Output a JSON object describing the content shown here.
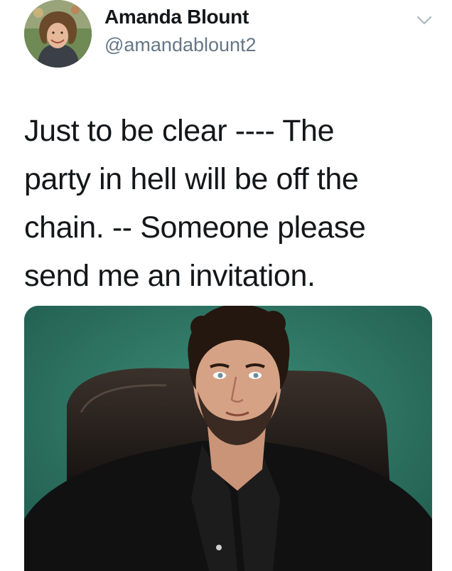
{
  "tweet": {
    "author_name": "Amanda Blount",
    "author_handle": "@amandablount2",
    "text_lines": [
      "Just to be clear ---- The",
      "party in hell will be off the",
      "chain. -- Someone please",
      "send me an invitation."
    ],
    "menu_icon": "chevron-down-icon",
    "avatar_icon": "user-avatar",
    "media_kind": "photo"
  },
  "colors": {
    "text": "#14171a",
    "secondary_text": "#657786",
    "chevron": "#aab8c2",
    "photo_background": "#2f7766"
  }
}
